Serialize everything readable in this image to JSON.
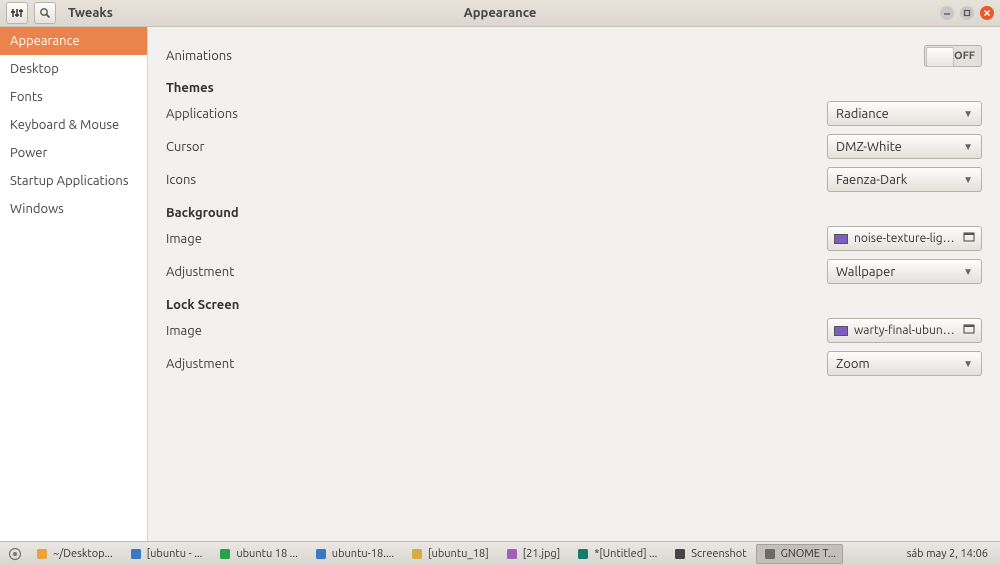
{
  "titlebar": {
    "app_name": "Tweaks",
    "page_title": "Appearance"
  },
  "sidebar": {
    "items": [
      {
        "label": "Appearance",
        "active": true
      },
      {
        "label": "Desktop",
        "active": false
      },
      {
        "label": "Fonts",
        "active": false
      },
      {
        "label": "Keyboard & Mouse",
        "active": false
      },
      {
        "label": "Power",
        "active": false
      },
      {
        "label": "Startup Applications",
        "active": false
      },
      {
        "label": "Windows",
        "active": false
      }
    ]
  },
  "content": {
    "animations": {
      "label": "Animations",
      "value": "OFF"
    },
    "themes": {
      "heading": "Themes",
      "applications": {
        "label": "Applications",
        "value": "Radiance"
      },
      "cursor": {
        "label": "Cursor",
        "value": "DMZ-White"
      },
      "icons": {
        "label": "Icons",
        "value": "Faenza-Dark"
      }
    },
    "background": {
      "heading": "Background",
      "image": {
        "label": "Image",
        "value": "noise-texture-light.png"
      },
      "adjustment": {
        "label": "Adjustment",
        "value": "Wallpaper"
      }
    },
    "lockscreen": {
      "heading": "Lock Screen",
      "image": {
        "label": "Image",
        "value": "warty-final-ubuntu.png"
      },
      "adjustment": {
        "label": "Adjustment",
        "value": "Zoom"
      }
    }
  },
  "taskbar": {
    "items": [
      {
        "label": "~/Desktop...",
        "icon_color": "#e8a33d"
      },
      {
        "label": "[ubuntu - ...",
        "icon_color": "#3a78c2"
      },
      {
        "label": "ubuntu 18 ...",
        "icon_color": "#2aa147"
      },
      {
        "label": "ubuntu-18....",
        "icon_color": "#3a78c2"
      },
      {
        "label": "[ubuntu_18]",
        "icon_color": "#d9ab46"
      },
      {
        "label": "[21.jpg]",
        "icon_color": "#a45fbd"
      },
      {
        "label": "*[Untitled] ...",
        "icon_color": "#167a6d"
      },
      {
        "label": "Screenshot",
        "icon_color": "#444"
      },
      {
        "label": "GNOME T...",
        "icon_color": "#6b6b6b",
        "active": true
      }
    ],
    "clock": "sáb may  2, 14:06"
  }
}
